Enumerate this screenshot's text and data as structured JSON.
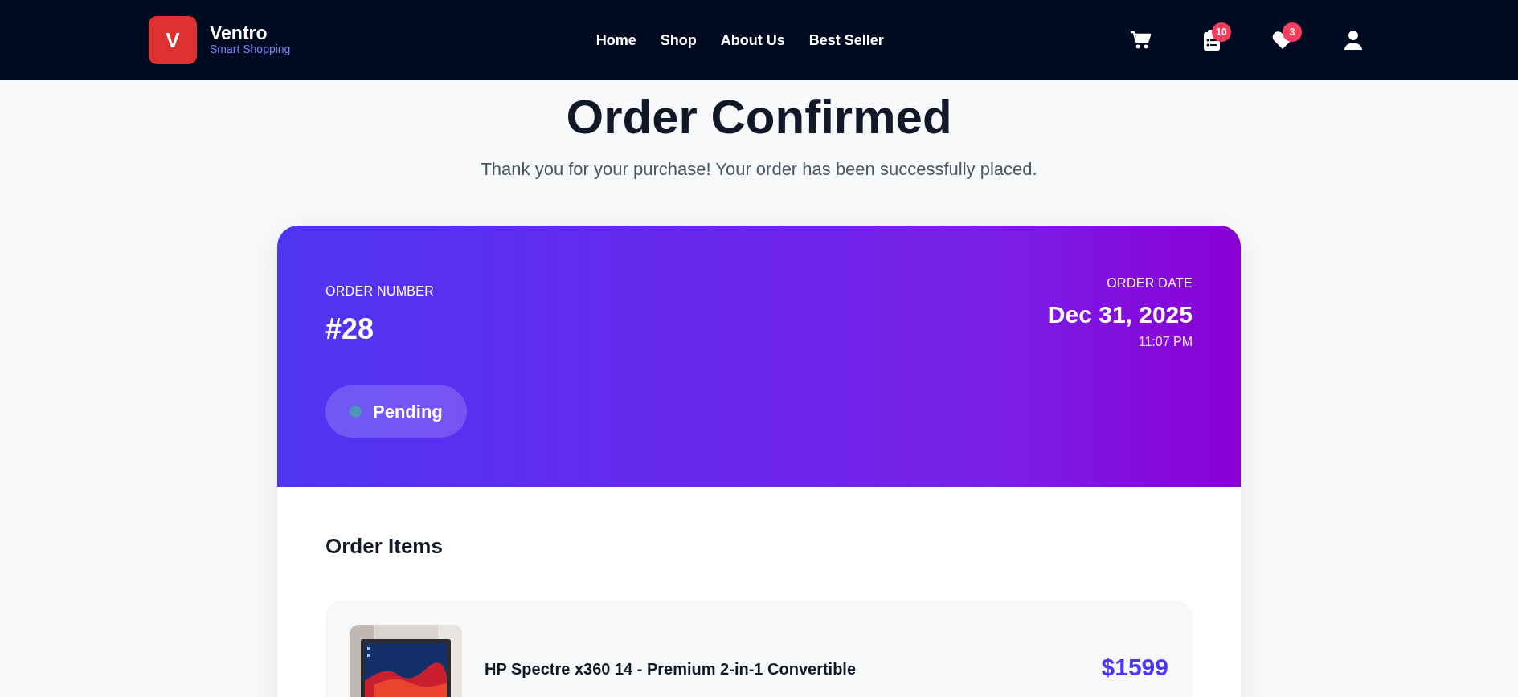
{
  "brand": {
    "logo_letter": "V",
    "name": "Ventro",
    "tagline": "Smart Shopping"
  },
  "nav": [
    {
      "label": "Home"
    },
    {
      "label": "Shop"
    },
    {
      "label": "About Us"
    },
    {
      "label": "Best Seller"
    }
  ],
  "actions": [
    {
      "kind": "cart"
    },
    {
      "kind": "orders",
      "badge": "10"
    },
    {
      "kind": "wishlist",
      "badge": "3"
    },
    {
      "kind": "account"
    }
  ],
  "heading": "Order Confirmed",
  "subheading": "Thank you for your purchase! Your order has been successfully placed.",
  "order": {
    "number_label": "ORDER NUMBER",
    "number": "#28",
    "date_label": "ORDER DATE",
    "date": "Dec 31, 2025",
    "time": "11:07 PM",
    "status": {
      "label": "Pending",
      "color": "#4a96b8"
    }
  },
  "items_title": "Order Items",
  "items": [
    {
      "kind": "picture",
      "name": "HP Spectre x360 14 - Premium 2-in-1 Convertible",
      "price": "$1599"
    }
  ]
}
